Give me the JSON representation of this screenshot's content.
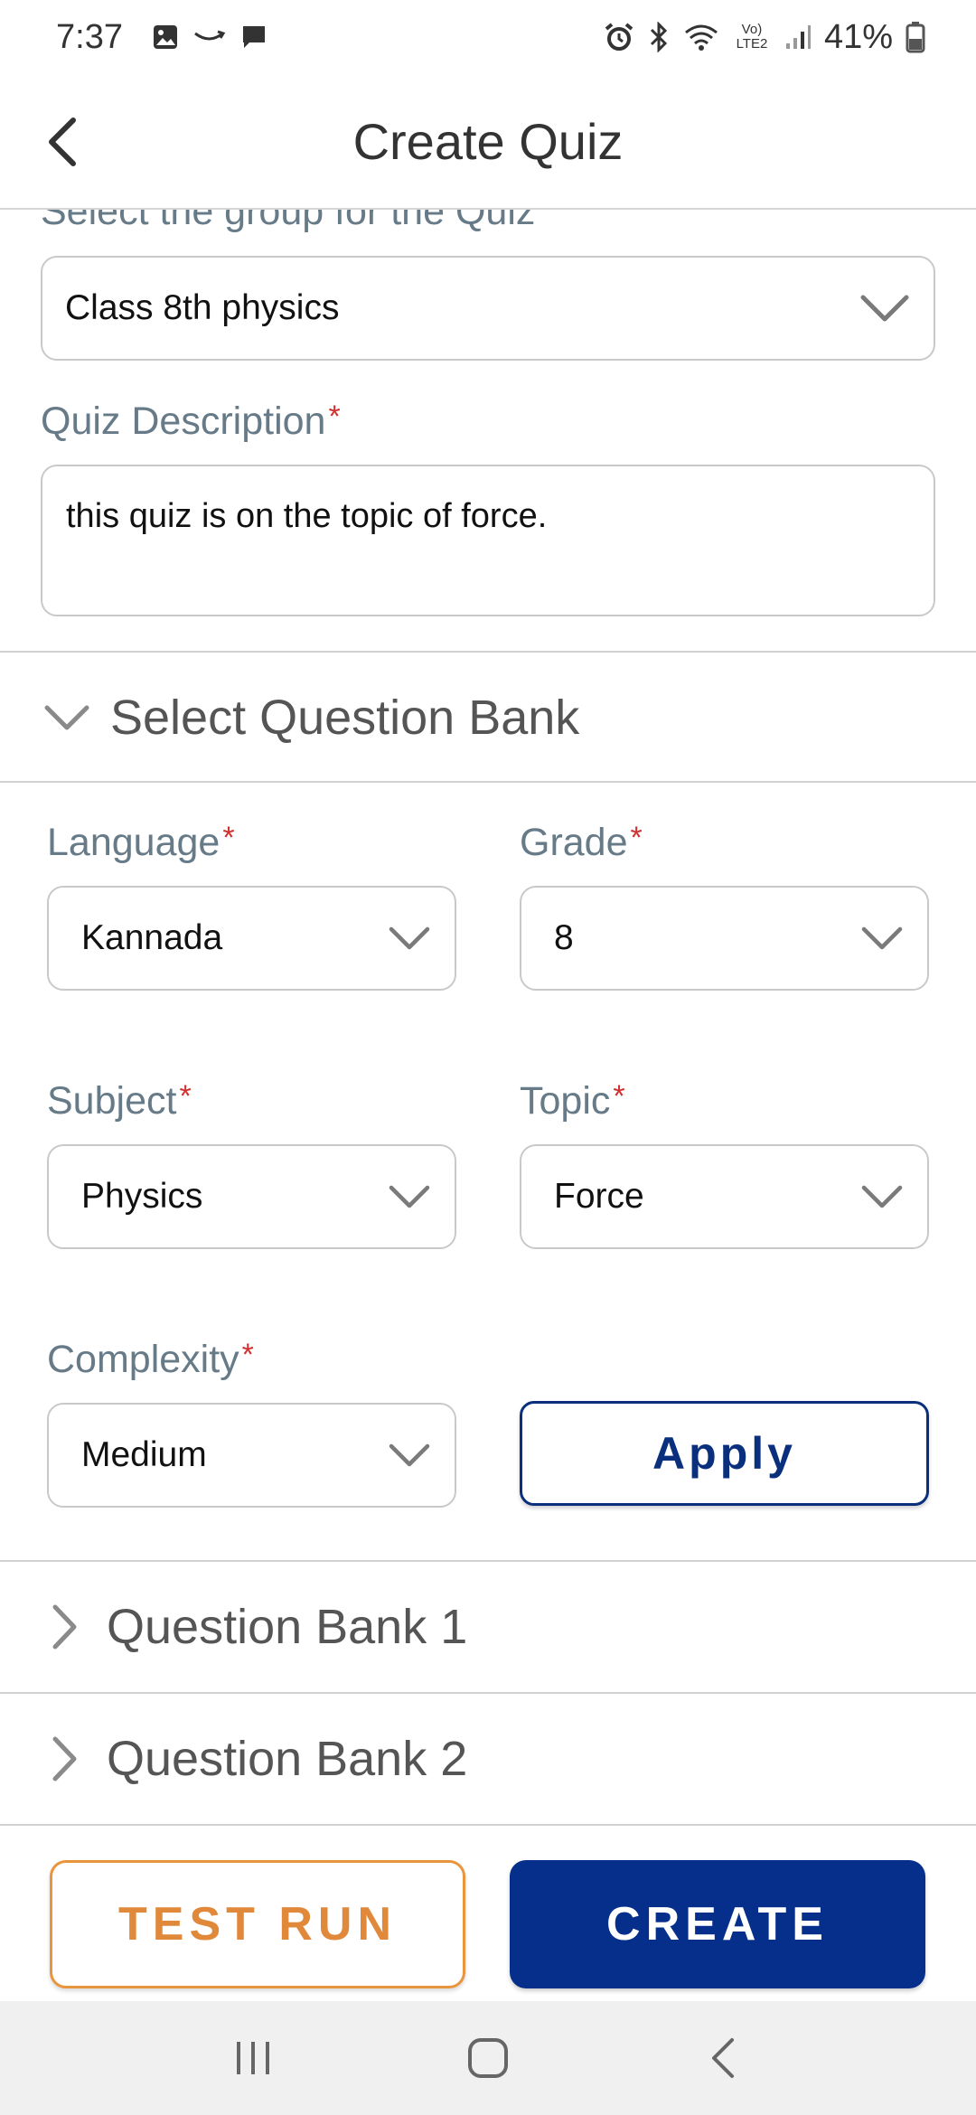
{
  "status_bar": {
    "time": "7:37",
    "battery_percent": "41%",
    "network_label": "Vo) LTE2",
    "left_icons": [
      "image-icon",
      "amazon-smile-icon",
      "message-icon"
    ],
    "right_icons": [
      "alarm-icon",
      "bluetooth-icon",
      "wifi-icon",
      "signal-icon",
      "battery-icon"
    ]
  },
  "header": {
    "title": "Create Quiz"
  },
  "group_field": {
    "label": "Select the group for the Quiz",
    "value": "Class 8th physics"
  },
  "description_field": {
    "label": "Quiz Description",
    "value": "this quiz is on the topic of force."
  },
  "question_bank_section": {
    "title": "Select Question Bank",
    "language": {
      "label": "Language",
      "value": "Kannada"
    },
    "grade": {
      "label": "Grade",
      "value": "8"
    },
    "subject": {
      "label": "Subject",
      "value": "Physics"
    },
    "topic": {
      "label": "Topic",
      "value": "Force"
    },
    "complexity": {
      "label": "Complexity",
      "value": "Medium"
    },
    "apply_label": "Apply"
  },
  "question_banks": [
    {
      "label": "Question Bank 1"
    },
    {
      "label": "Question Bank 2"
    }
  ],
  "actions": {
    "test_run_label": "TEST RUN",
    "create_label": "CREATE"
  },
  "required_marker": "*",
  "colors": {
    "brand_blue": "#062f8c",
    "accent_orange": "#e0893a",
    "required_red": "#d32f2f",
    "label_gray": "#667a87"
  }
}
